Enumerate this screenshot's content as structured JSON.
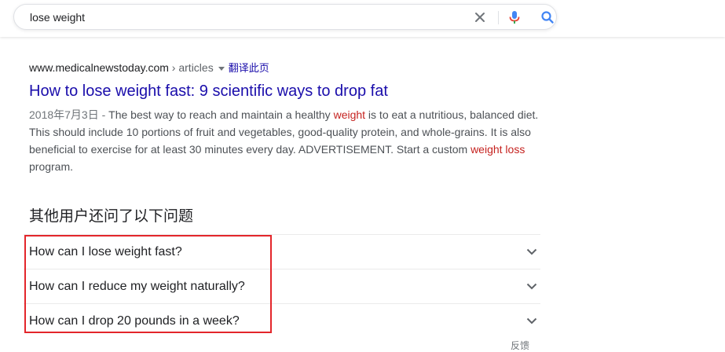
{
  "search": {
    "query": "lose weight"
  },
  "result": {
    "domain": "www.medicalnewstoday.com",
    "path": " › articles",
    "translate_label": "翻译此页",
    "title": "How to lose weight fast: 9 scientific ways to drop fat",
    "date": "2018年7月3日 - ",
    "snippet_1": "The best way to reach and maintain a healthy ",
    "snippet_hl1": "weight",
    "snippet_2": " is to eat a nutritious, balanced diet. This should include 10 portions of fruit and vegetables, good-quality protein, and whole-grains. It is also beneficial to exercise for at least 30 minutes every day. ADVERTISEMENT. Start a custom ",
    "snippet_hl2": "weight loss",
    "snippet_3": " program."
  },
  "people_also_ask": {
    "title": "其他用户还问了以下问题",
    "questions": [
      "How can I lose weight fast?",
      "How can I reduce my weight naturally?",
      "How can I drop 20 pounds in a week?"
    ]
  },
  "feedback_label": "反馈",
  "colors": {
    "link": "#1a0dab",
    "highlight_text": "#c5221f",
    "annotation_box": "#e3262b",
    "mic_blue": "#4285f4",
    "mic_red": "#ea4335"
  },
  "icons": [
    "clear-icon",
    "mic-icon",
    "search-icon",
    "dropdown-caret-icon",
    "chevron-down-icon"
  ]
}
